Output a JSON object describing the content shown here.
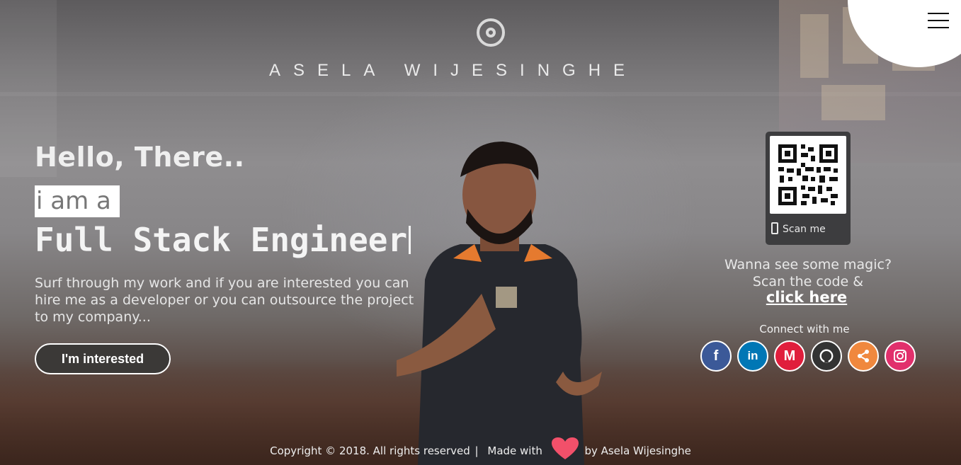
{
  "header": {
    "site_name": "ASELA WIJESINGHE",
    "logo_icon": "target-circle-icon",
    "menu_icon": "hamburger-menu-icon"
  },
  "hero": {
    "greeting": "Hello, There..",
    "intro": "i am a",
    "role": "Full Stack Engineer",
    "description": "Surf through my work and if you are interested you can hire me as a developer or you can outsource the project to my company...",
    "cta_label": "I'm interested"
  },
  "qr_panel": {
    "scan_label": "Scan me",
    "magic_text": "Wanna see some magic? Scan the code &",
    "link_text": "click here"
  },
  "connect": {
    "title": "Connect with me",
    "links": [
      {
        "icon": "facebook-icon",
        "glyph": "f",
        "color": "#3b5998"
      },
      {
        "icon": "linkedin-icon",
        "glyph": "in",
        "color": "#0077b5"
      },
      {
        "icon": "medium-icon",
        "glyph": "M",
        "color": "#e01e3c"
      },
      {
        "icon": "github-icon",
        "glyph": "GH",
        "color": "#333333"
      },
      {
        "icon": "share-icon",
        "glyph": "<",
        "color": "#f0883e"
      },
      {
        "icon": "instagram-icon",
        "glyph": "◎",
        "color": "#e1306c"
      }
    ]
  },
  "footer": {
    "copyright": "Copyright © 2018. All rights reserved",
    "separator": "|",
    "made_with": "Made with",
    "by": "by Asela Wijesinghe",
    "heart_color": "#f2506a"
  }
}
